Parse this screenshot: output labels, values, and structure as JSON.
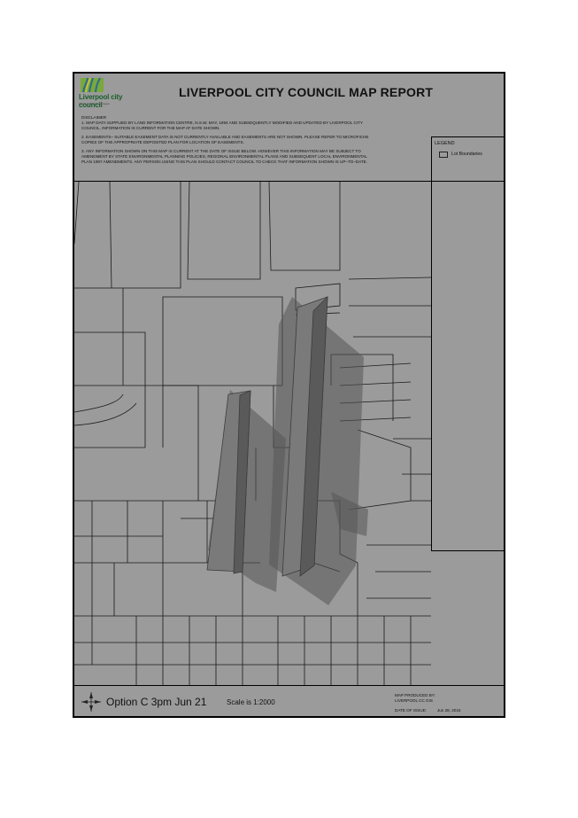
{
  "report": {
    "title": "LIVERPOOL CITY COUNCIL MAP REPORT",
    "logo_text": "Liverpool city council",
    "logo_tagline": "nature and heritage region"
  },
  "disclaimer": {
    "heading": "DISCLAIMER",
    "items": [
      "1. MAP DATA SUPPLIED BY LAND INFORMATION CENTRE, N.S.W. MAY, 1994 AND SUBSEQUENTLY MODIFIED AND UPDATED BY LIVERPOOL CITY COUNCIL. INFORMATION IS CURRENT FOR THE MAP AT DATE SHOWN.",
      "2. EASEMENTS– SUITABLE EASEMENT DATA IS NOT CURRENTLY AVAILABLE AND EASEMENTS ARE NOT SHOWN. PLEASE REFER TO MICROFICHE COPIES OF THE APPROPRIATE DEPOSITED PLAN FOR LOCATION OF EASEMENTS.",
      "3. ANY INFORMATION SHOWN ON THIS MAP IS CURRENT AT THE DATE OF ISSUE BELOW. HOWEVER THIS INFORMATION MAY BE SUBJECT TO AMENDMENT BY STATE ENVIRONMENTAL PLANNING POLICIES, REGIONAL ENVIRONMENTAL PLANS AND SUBSEQUENT LOCAL ENVIRONMENTAL PLAN 1997 AMENDMENTS. ANY PERSON USING THIS PLAN SHOULD CONTACT COUNCIL TO CHECK THAT INFORMATION SHOWN IS UP–TO–DATE."
    ]
  },
  "legend": {
    "title": "LEGEND",
    "items": [
      {
        "label": "Lot Boundaries"
      }
    ]
  },
  "footer": {
    "option_label": "Option C 3pm Jun 21",
    "scale_label": "Scale is 1:2000",
    "producer_line1": "MAP PRODUCED BY:",
    "producer_line2": "LIVERPOOL CC GIS",
    "issue_label": "DATE OF ISSUE:",
    "issue_date": "Jun 28, 2016"
  },
  "colors": {
    "background": "#9b9b9b",
    "lot_line": "#1a1a1a",
    "shadow": "#555555",
    "building_face": "#7a7a7a",
    "building_edge": "#3c3c3c"
  },
  "icons": {
    "compass": "north-arrow-icon",
    "logo": "council-logo-icon"
  }
}
